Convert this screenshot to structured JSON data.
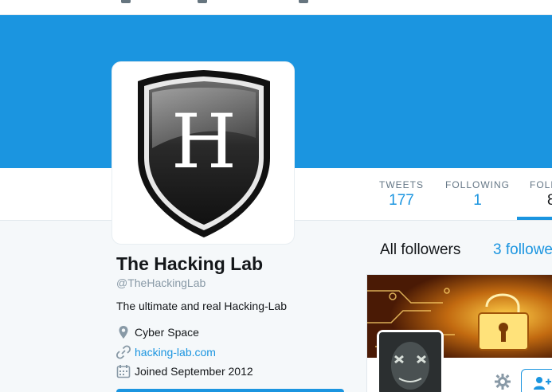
{
  "profile": {
    "name": "The Hacking Lab",
    "handle": "@TheHackingLab",
    "bio": "The ultimate and real Hacking-Lab",
    "location": "Cyber Space",
    "website": "hacking-lab.com",
    "joined": "Joined September 2012",
    "avatar_letter": "H"
  },
  "stats": {
    "tweets_label": "TWEETS",
    "tweets_value": "177",
    "following_label": "FOLLOWING",
    "following_value": "1",
    "followers_label": "FOLL",
    "followers_value": "8"
  },
  "followers_panel": {
    "all_label": "All followers",
    "count_label": "3 followe"
  },
  "colors": {
    "accent": "#1b95e0",
    "background": "#f5f8fa",
    "text": "#14171a"
  },
  "icons": [
    "home-icon",
    "moments-icon",
    "notifications-icon",
    "location-icon",
    "link-icon",
    "calendar-icon",
    "gear-icon",
    "follow-user-icon"
  ]
}
